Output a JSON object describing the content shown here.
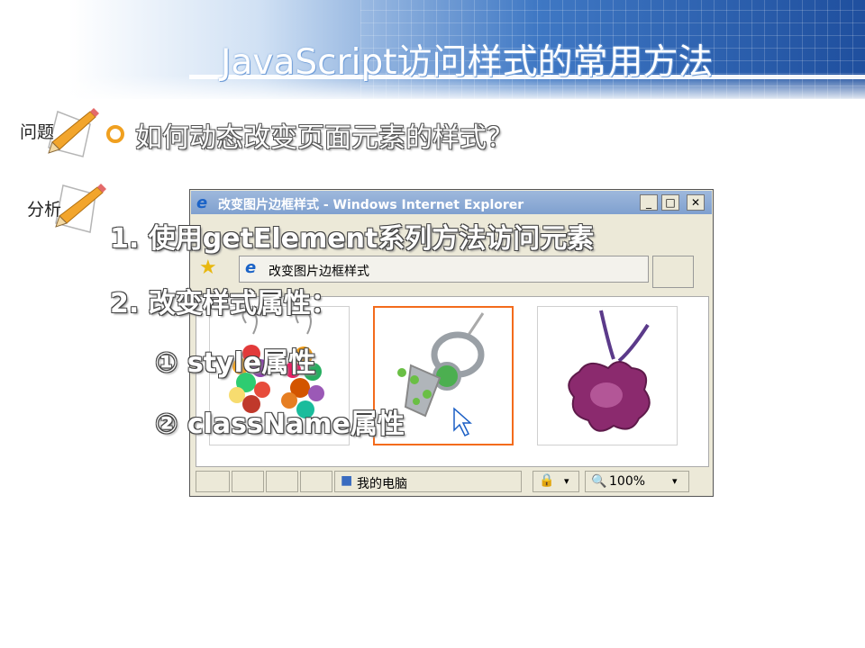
{
  "slide": {
    "title": "JavaScript访问样式的常用方法",
    "question_label": "问题",
    "analysis_label": "分析",
    "question_text": "如何动态改变页面元素的样式？",
    "points": [
      "1. 使用getElement系列方法访问元素",
      "2. 改变样式属性：",
      "①  style属性",
      "②  className属性"
    ]
  },
  "browser": {
    "window_title": "改变图片边框样式 - Windows Internet Explorer",
    "tab_title": "改变图片边框样式",
    "status_zone": "我的电脑",
    "zoom": "100%",
    "min_symbol": "_",
    "max_symbol": "□",
    "close_symbol": "✕",
    "dropdown_symbol": "▾",
    "images": [
      {
        "name": "earrings-image",
        "selected": false
      },
      {
        "name": "pendant-image",
        "selected": true
      },
      {
        "name": "flower-pendant-image",
        "selected": false
      }
    ]
  },
  "colors": {
    "banner_blue": "#3f78c4",
    "bullet_orange": "#f0a020",
    "selected_border": "#f36b1c"
  }
}
